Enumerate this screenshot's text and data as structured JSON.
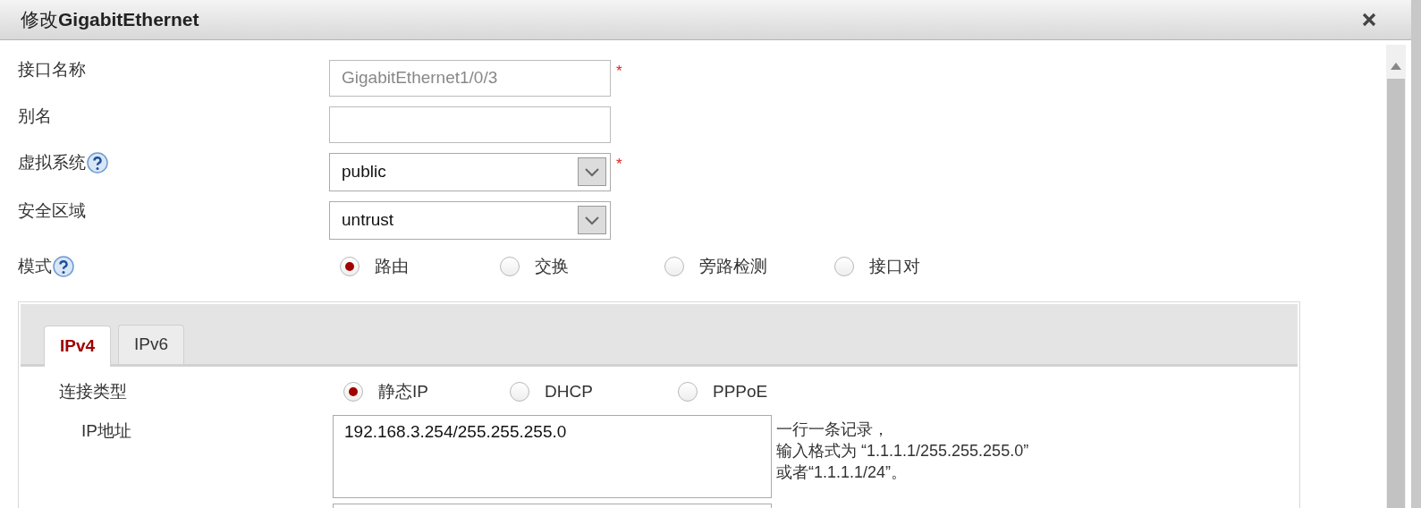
{
  "dialog": {
    "title": "修改**GigabitEthernet**"
  },
  "fields": [
    {
      "kind": "text",
      "label": "接口名称",
      "value": "GigabitEthernet1/0/3",
      "disabled": true,
      "required_mark": "*"
    },
    {
      "kind": "text",
      "label": "别名"
    },
    {
      "kind": "select",
      "label": "虚拟系统",
      "help": true,
      "value": "public",
      "required_mark": "*"
    },
    {
      "kind": "select",
      "label": "安全区域",
      "value": "untrust"
    },
    {
      "kind": "radio",
      "label": "模式",
      "help": true,
      "options": [
        {
          "label": "路由",
          "selected": true
        },
        {
          "label": "交换",
          "selected": false
        },
        {
          "label": "旁路检测",
          "selected": false
        },
        {
          "label": "接口对",
          "selected": false
        }
      ]
    }
  ],
  "tabs": [
    {
      "label": "IPv4",
      "selected": true
    },
    {
      "label": "IPv6",
      "selected": false
    }
  ],
  "ipv4": {
    "connection_type": {
      "label": "连接类型",
      "options": [
        {
          "label": "静态IP",
          "selected": true
        },
        {
          "label": "DHCP",
          "selected": false
        },
        {
          "label": "PPPoE",
          "selected": false
        }
      ]
    },
    "ip_address": {
      "label": "IP地址",
      "value": "192.168.3.254/255.255.255.0",
      "hint_lines": [
        "一行一条记录，",
        "输入格式为 “1.1.1.1/255.255.255.0”",
        "或者“1.1.1.1/24”。"
      ]
    }
  }
}
